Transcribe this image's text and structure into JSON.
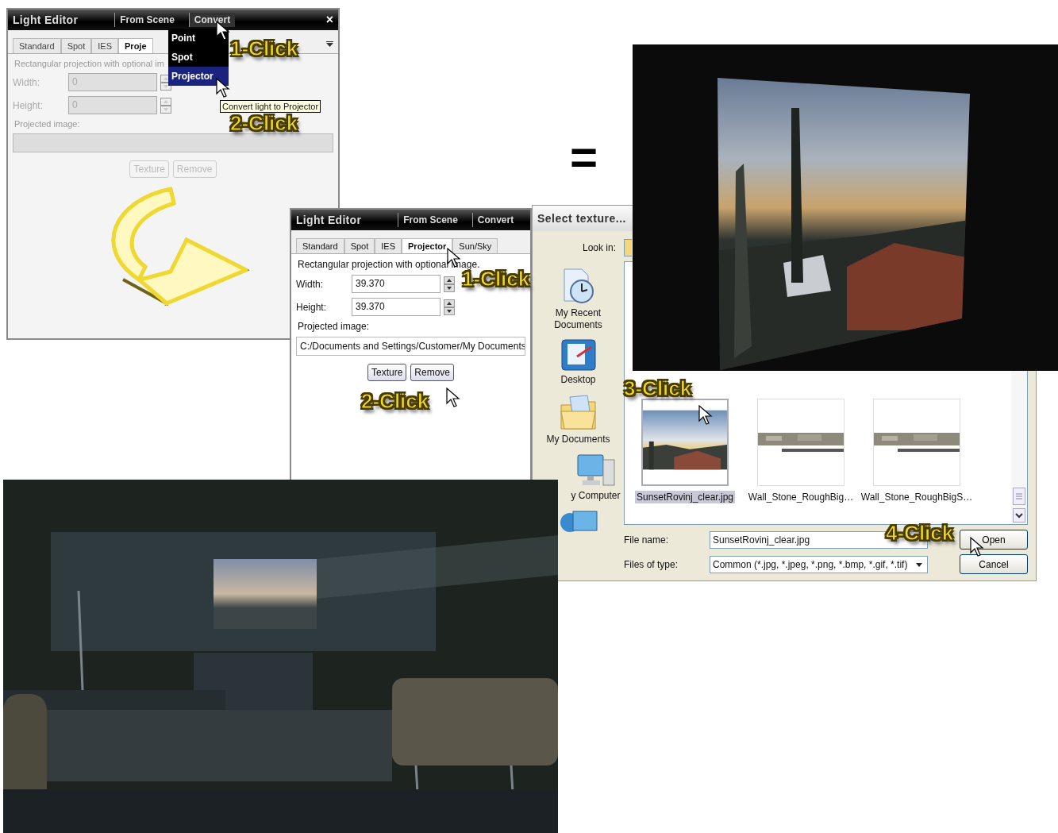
{
  "editor_before": {
    "title": "Light Editor",
    "menu": [
      {
        "label": "From Scene",
        "open": false
      },
      {
        "label": "Convert",
        "open": true
      }
    ],
    "close": "×",
    "disabled": true,
    "tabs": [
      {
        "label": "Standard",
        "selected": false
      },
      {
        "label": "Spot",
        "selected": false
      },
      {
        "label": "IES",
        "selected": false
      },
      {
        "label": "Proje",
        "selected": true
      }
    ],
    "dropdown": [
      {
        "label": "Point",
        "selected": false
      },
      {
        "label": "Spot",
        "selected": false
      },
      {
        "label": "Projector",
        "selected": true
      }
    ],
    "tooltip": "Convert light to Projector",
    "description": "Rectangular projection with optional im",
    "fields": [
      {
        "label": "Width:",
        "value": "0"
      },
      {
        "label": "Height:",
        "value": "0"
      }
    ],
    "image_label": "Projected image:",
    "buttons": [
      "Texture",
      "Remove"
    ],
    "callouts": [
      "1-Click",
      "2-Click"
    ]
  },
  "equals_sign": "=",
  "editor_after": {
    "title": "Light Editor",
    "menu": [
      {
        "label": "From Scene",
        "open": false
      },
      {
        "label": "Convert",
        "open": false
      }
    ],
    "disabled": false,
    "tabs": [
      {
        "label": "Standard",
        "selected": false
      },
      {
        "label": "Spot",
        "selected": false
      },
      {
        "label": "IES",
        "selected": false
      },
      {
        "label": "Projector",
        "selected": true
      },
      {
        "label": "Sun/Sky",
        "selected": false
      }
    ],
    "description": "Rectangular projection with optional image.",
    "fields": [
      {
        "label": "Width:",
        "value": "39.370"
      },
      {
        "label": "Height:",
        "value": "39.370"
      }
    ],
    "image_label": "Projected image:",
    "image_path": "C:/Documents and Settings/Customer/My Documents",
    "buttons": [
      "Texture",
      "Remove"
    ],
    "callouts": [
      "1-Click",
      "2-Click"
    ]
  },
  "file_dialog": {
    "title": "Select texture...",
    "look_in": "Look in:",
    "places": [
      {
        "kind": "recent",
        "label": "My Recent Documents"
      },
      {
        "kind": "desktop",
        "label": "Desktop"
      },
      {
        "kind": "documents",
        "label": "My Documents"
      },
      {
        "kind": "computer",
        "label": "y Computer"
      },
      {
        "kind": "network"
      }
    ],
    "files": [
      {
        "name": "SunsetRovinj_clear.jpg",
        "selected": true
      },
      {
        "kind": "stone",
        "name": "Wall_Stone_RoughBig…",
        "selected": false
      },
      {
        "kind": "stone",
        "name": "Wall_Stone_RoughBigS…",
        "selected": false
      }
    ],
    "file_name": {
      "label": "File name:",
      "value": "SunsetRovinj_clear.jpg"
    },
    "file_type": {
      "label": "Files of type:",
      "value": "Common (*.jpg, *.jpeg, *.png, *.bmp, *.gif, *.tif)"
    },
    "buttons": [
      "Open",
      "Cancel"
    ],
    "callouts": [
      "3-Click",
      "4-Click"
    ]
  }
}
